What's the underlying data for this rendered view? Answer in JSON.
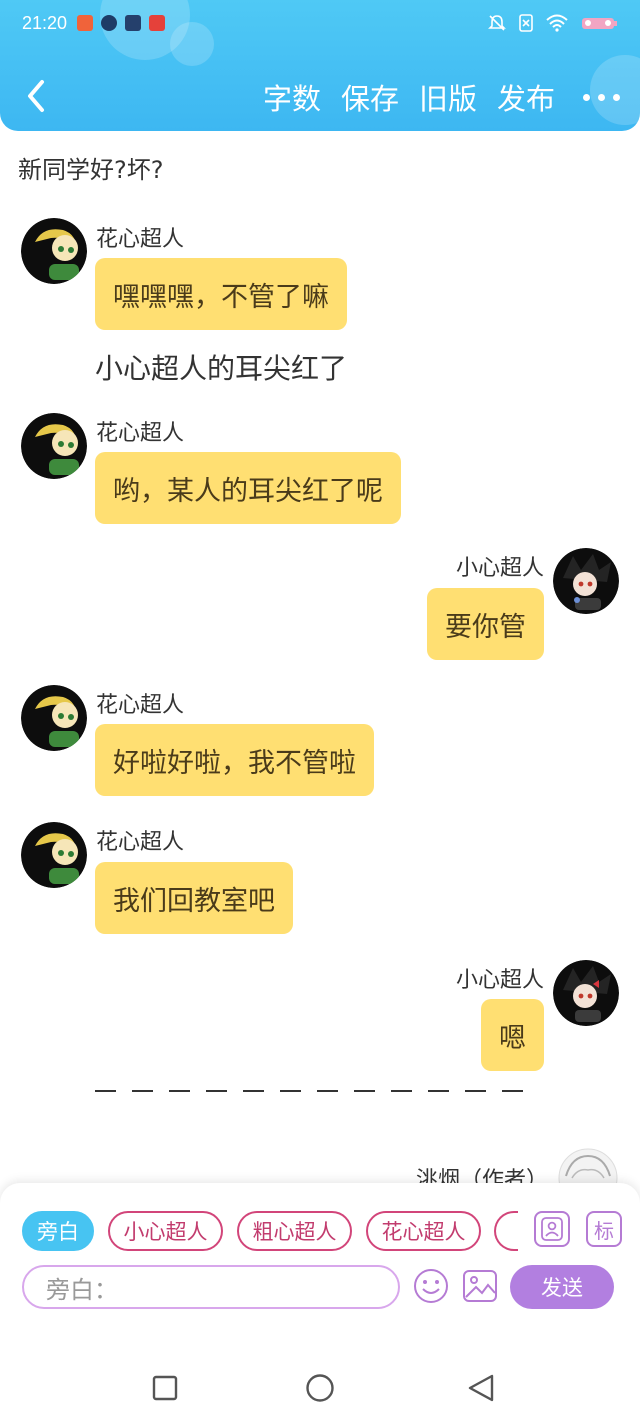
{
  "status_bar": {
    "time": "21:20",
    "app_icons": [
      "red-app-icon",
      "player-app-icon",
      "book-app-icon",
      "red-game-icon"
    ],
    "right_icons": [
      "mute-icon",
      "sim-icon",
      "wifi-icon",
      "battery-icon"
    ]
  },
  "header": {
    "back_icon": "chevron-left-icon",
    "actions": {
      "word_count": "字数",
      "save": "保存",
      "old_version": "旧版",
      "publish": "发布"
    },
    "more_icon": "more-dots-icon",
    "colors": {
      "background": "#3db7f2"
    }
  },
  "story": {
    "title_line": "新同学好?坏?",
    "messages": [
      {
        "speaker": "花心超人",
        "text": "嘿嘿嘿，不管了嘛"
      },
      {
        "speaker": "花心超人",
        "text": "哟，某人的耳尖红了呢"
      },
      {
        "speaker": "小心超人",
        "text": "要你管"
      },
      {
        "speaker": "花心超人",
        "text": "好啦好啦，我不管啦"
      },
      {
        "speaker": "花心超人",
        "text": "我们回教室吧"
      },
      {
        "speaker": "小心超人",
        "text": "嗯"
      }
    ],
    "narration": "小心超人的耳尖红了",
    "author": "洮烟（作者）",
    "bubble_color": "#ffdf72"
  },
  "composer": {
    "roles": [
      "旁白",
      "小心超人",
      "粗心超人",
      "花心超人"
    ],
    "active_role": "旁白",
    "input_placeholder": "旁白：",
    "send_label": "发送",
    "tool_icons": [
      "contact-card-icon",
      "tag-icon",
      "emoji-icon",
      "image-icon"
    ],
    "tag_label": "标"
  },
  "system_nav": {
    "buttons": [
      "square-recent-icon",
      "circle-home-icon",
      "triangle-back-icon"
    ]
  }
}
